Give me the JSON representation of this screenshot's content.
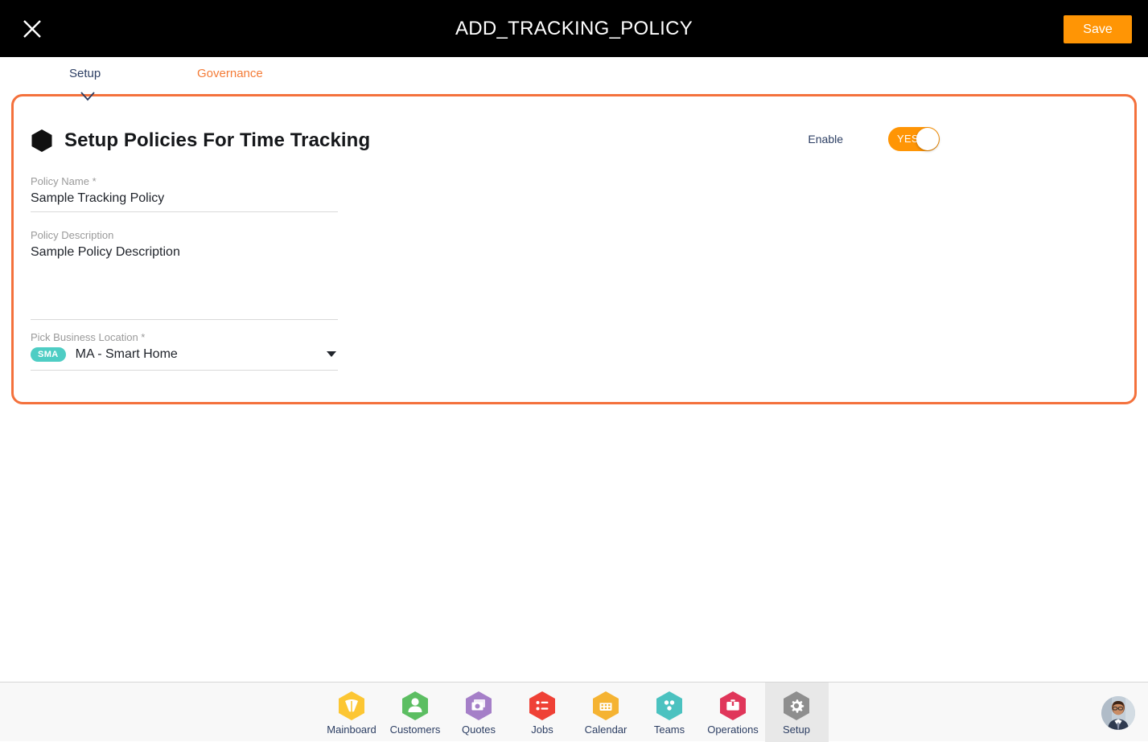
{
  "header": {
    "title": "ADD_TRACKING_POLICY",
    "close_icon": "close-icon",
    "save_label": "Save"
  },
  "tabs": [
    {
      "label": "Setup",
      "active": true
    },
    {
      "label": "Governance",
      "active": false
    }
  ],
  "card": {
    "title": "Setup Policies For Time Tracking",
    "icon": "hexagon-icon",
    "enable": {
      "label": "Enable",
      "toggle_text": "YES",
      "on": true
    },
    "fields": {
      "policy_name": {
        "label": "Policy Name *",
        "value": "Sample Tracking Policy",
        "placeholder": "Policy Name"
      },
      "policy_description": {
        "label": "Policy Description",
        "value": "Sample Policy Description",
        "placeholder": "Policy Description"
      },
      "business_location": {
        "label": "Pick Business Location *",
        "badge": "SMA",
        "value": "MA - Smart Home"
      }
    }
  },
  "bottom_nav": {
    "items": [
      {
        "label": "Mainboard",
        "icon": "mainboard-icon",
        "color": "#fcc633",
        "active": false
      },
      {
        "label": "Customers",
        "icon": "customers-icon",
        "color": "#5cbe62",
        "active": false
      },
      {
        "label": "Quotes",
        "icon": "quotes-icon",
        "color": "#a57fc8",
        "active": false
      },
      {
        "label": "Jobs",
        "icon": "jobs-icon",
        "color": "#ef4136",
        "active": false
      },
      {
        "label": "Calendar",
        "icon": "calendar-icon",
        "color": "#f5b332",
        "active": false
      },
      {
        "label": "Teams",
        "icon": "teams-icon",
        "color": "#4bc2c0",
        "active": false
      },
      {
        "label": "Operations",
        "icon": "operations-icon",
        "color": "#e0365a",
        "active": false
      },
      {
        "label": "Setup",
        "icon": "gear-icon",
        "color": "#8e8e8e",
        "active": true
      }
    ],
    "avatar": "user-avatar"
  },
  "colors": {
    "accent_orange": "#ff9505",
    "card_border": "#f4713c",
    "badge_teal": "#4ecdc4",
    "nav_text": "#2c3e63"
  }
}
